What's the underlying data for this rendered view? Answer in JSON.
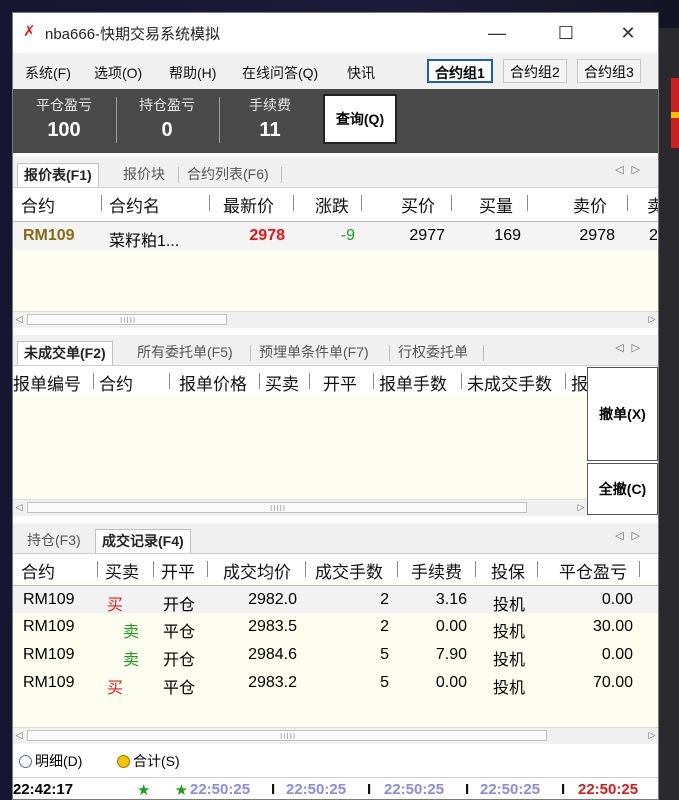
{
  "window": {
    "title": "nba666-快期交易系统模拟",
    "controls": {
      "minimize": "—",
      "maximize": "☐",
      "close": "✕"
    }
  },
  "menu": {
    "items": [
      "系统(F)",
      "选项(O)",
      "帮助(H)",
      "在线问答(Q)",
      "快讯"
    ],
    "groups": [
      "合约组1",
      "合约组2",
      "合约组3"
    ],
    "active_group": "合约组1"
  },
  "stats": {
    "close_pnl": {
      "label": "平仓盈亏",
      "value": "100"
    },
    "pos_pnl": {
      "label": "持仓盈亏",
      "value": "0"
    },
    "fee": {
      "label": "手续费",
      "value": "11"
    },
    "query_button": "查询(Q)"
  },
  "quote_panel": {
    "tabs": [
      "报价表(F1)",
      "报价块",
      "合约列表(F6)"
    ],
    "headers": [
      "合约",
      "合约名",
      "最新价",
      "涨跌",
      "买价",
      "买量",
      "卖价",
      "卖"
    ],
    "row": {
      "symbol": "RM109",
      "name": "菜籽粕1...",
      "last": "2978",
      "change": "-9",
      "bid": "2977",
      "bid_vol": "169",
      "ask": "2978",
      "ask_vol": "2"
    }
  },
  "order_panel": {
    "tabs": [
      "未成交单(F2)",
      "所有委托单(F5)",
      "预埋单条件单(F7)",
      "行权委托单"
    ],
    "headers": [
      "报单编号",
      "合约",
      "报单价格",
      "买卖",
      "开平",
      "报单手数",
      "未成交手数",
      "报"
    ],
    "cancel_button": "撤单(X)",
    "cancel_all_button": "全撤(C)"
  },
  "trade_panel": {
    "tabs": [
      "持仓(F3)",
      "成交记录(F4)"
    ],
    "headers": [
      "合约",
      "买卖",
      "开平",
      "成交均价",
      "成交手数",
      "手续费",
      "投保",
      "平仓盈亏"
    ],
    "rows": [
      {
        "symbol": "RM109",
        "side": "买",
        "oc": "开仓",
        "price": "2982.0",
        "qty": "2",
        "fee": "3.16",
        "hedge": "投机",
        "pnl": "0.00"
      },
      {
        "symbol": "RM109",
        "side": "卖",
        "oc": "平仓",
        "price": "2983.5",
        "qty": "2",
        "fee": "0.00",
        "hedge": "投机",
        "pnl": "30.00"
      },
      {
        "symbol": "RM109",
        "side": "卖",
        "oc": "开仓",
        "price": "2984.6",
        "qty": "5",
        "fee": "7.90",
        "hedge": "投机",
        "pnl": "0.00"
      },
      {
        "symbol": "RM109",
        "side": "买",
        "oc": "平仓",
        "price": "2983.2",
        "qty": "5",
        "fee": "0.00",
        "hedge": "投机",
        "pnl": "70.00"
      }
    ]
  },
  "footer": {
    "radio_detail": "明细(D)",
    "radio_total": "合计(S)",
    "selected": "合计(S)"
  },
  "status": {
    "clock": "22:42:17",
    "stars": "★ ★",
    "times": [
      "22:50:25",
      "22:50:25",
      "22:50:25",
      "22:50:25",
      "22:50:25"
    ],
    "separator": "I"
  },
  "colors": {
    "buy": "#e02020",
    "sell": "#1aa01a",
    "price_up": "#ee1111",
    "symbol_gold": "#8a6a10",
    "accent_blue": "#1a5fb4",
    "status_time": "#8a8ae6",
    "status_time_last": "#e01818"
  }
}
